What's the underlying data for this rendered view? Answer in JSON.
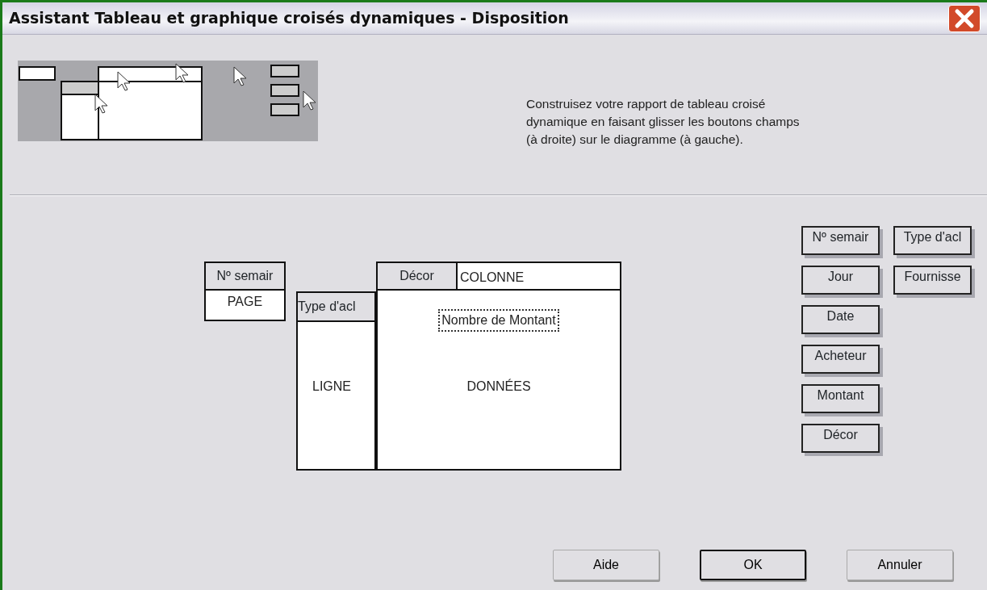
{
  "window": {
    "title": "Assistant Tableau et graphique croisés dynamiques - Disposition"
  },
  "instructions": "Construisez votre rapport de tableau croisé dynamique en faisant glisser les boutons champs (à droite) sur le diagramme (à gauche).",
  "layout": {
    "page_area": {
      "field": "Nº semair",
      "label": "PAGE"
    },
    "row_area": {
      "field": "Type d'acl",
      "label": "LIGNE"
    },
    "column_area": {
      "field": "Décor",
      "label": "COLONNE"
    },
    "data_area": {
      "field": "Nombre de Montant",
      "label": "DONNÉES"
    }
  },
  "fields": [
    "Nº semair",
    "Jour",
    "Date",
    "Acheteur",
    "Montant",
    "Décor",
    "Type d'acl",
    "Fournisse"
  ],
  "buttons": [
    {
      "label": "Aide",
      "default": false
    },
    {
      "label": "OK",
      "default": true
    },
    {
      "label": "Annuler",
      "default": false
    }
  ]
}
